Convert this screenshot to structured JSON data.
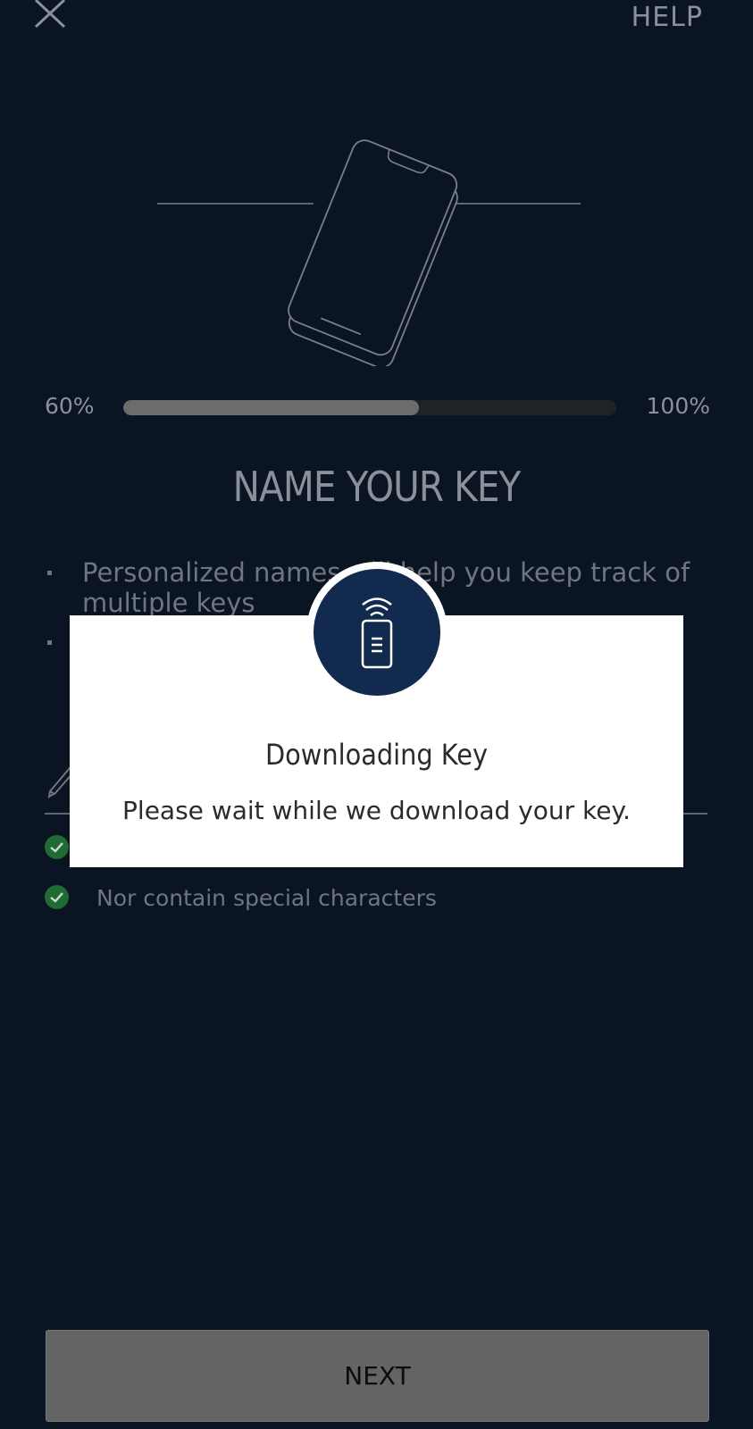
{
  "header": {
    "close_icon": "close-icon",
    "help_label": "HELP"
  },
  "progress": {
    "start_label": "60%",
    "end_label": "100%",
    "fill_fraction": 0.6
  },
  "page": {
    "title": "NAME YOUR KEY",
    "tips": [
      {
        "text": "Personalized names will help you keep track of multiple keys"
      },
      {
        "text": ""
      }
    ],
    "name_field_icon": "pencil-icon",
    "rules": [
      {
        "text": "",
        "icon": "check-icon"
      },
      {
        "text": "Nor contain special characters",
        "icon": "check-icon"
      }
    ]
  },
  "footer": {
    "next_label": "NEXT"
  },
  "modal": {
    "icon": "phone-key-download-icon",
    "title": "Downloading Key",
    "message": "Please wait while we download your key."
  },
  "colors": {
    "background": "#0a1422",
    "modal_icon_bg": "#112a4d",
    "check_green": "#1f6b34",
    "button_gray": "#646464"
  }
}
